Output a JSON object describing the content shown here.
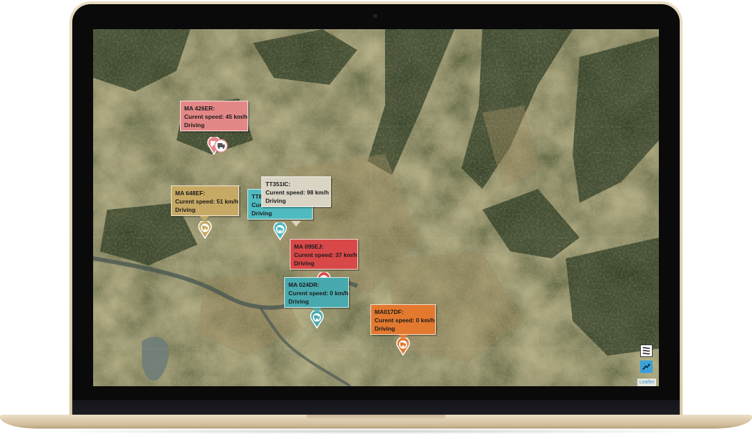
{
  "map": {
    "attribution": "Leaflet",
    "colors": {
      "forest": "#2e3b22",
      "fields": "#8a7a55",
      "river": "#4d5a55"
    }
  },
  "vehicles": [
    {
      "plate": "MA 426ER:",
      "speed": "Curent speed: 45 km/h",
      "status": "Driving",
      "color": "#e48787",
      "icon": "truck-icon"
    },
    {
      "plate": "MA 648EF:",
      "speed": "Curent speed: 51 km/h",
      "status": "Driving",
      "color": "#c6a964",
      "icon": "truck-icon"
    },
    {
      "plate": "TT8",
      "speed": "Cur",
      "status": "Driving",
      "color": "#4fbac0",
      "icon": "truck-icon"
    },
    {
      "plate": "TT351IC:",
      "speed": "Curent speed: 98 km/h",
      "status": "Driving",
      "color": "#d9d4c4",
      "icon": "truck-icon"
    },
    {
      "plate": "MA 095EJ:",
      "speed": "Curent speed: 37 km/h",
      "status": "Driving",
      "color": "#d94848",
      "icon": "truck-icon"
    },
    {
      "plate": "MA 024DR:",
      "speed": "Curent speed: 0 km/h",
      "status": "Driving",
      "color": "#48aaae",
      "icon": "truck-icon"
    },
    {
      "plate": "MA017DF:",
      "speed": "Curent speed: 0 km/h",
      "status": "Driving",
      "color": "#e3792f",
      "icon": "truck-icon"
    }
  ],
  "controls": {
    "layers_icon": "layers-icon",
    "locate_icon": "locate-icon"
  }
}
